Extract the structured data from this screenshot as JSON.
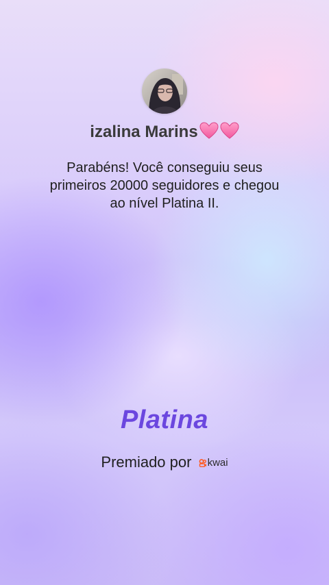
{
  "profile": {
    "name": "izalina Marins",
    "avatar_icon": "profile-photo"
  },
  "message": "Parabéns! Você conseguiu seus primeiros 20000 seguidores e chegou ao nível Platina II.",
  "level": {
    "title": "Platina",
    "color": "#6b47df"
  },
  "awarded": {
    "label": "Premiado por",
    "brand": "kwai",
    "brand_color": "#ff5a1f"
  }
}
